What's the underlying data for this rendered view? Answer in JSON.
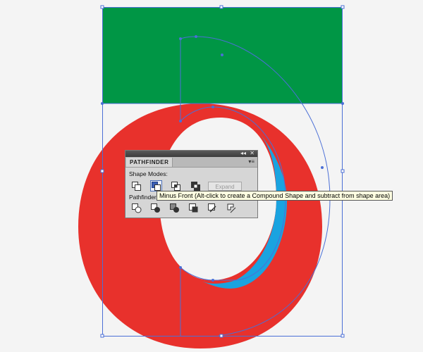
{
  "canvas": {
    "colors": {
      "background": "#f4f4f4",
      "rectangle": "#009645",
      "ring": "#e8312c",
      "inner_shadow": "#1aa3e0",
      "selection": "#4b6fd6"
    }
  },
  "panel": {
    "collapse_icon": "double-left-arrows-icon",
    "close_icon": "close-icon",
    "tab_label": "PATHFINDER",
    "menu_icon": "panel-menu-icon",
    "shape_modes_label": "Shape Modes:",
    "shape_modes": [
      {
        "name": "unite-icon"
      },
      {
        "name": "minus-front-icon",
        "active": true
      },
      {
        "name": "intersect-icon"
      },
      {
        "name": "exclude-icon"
      }
    ],
    "expand_label": "Expand",
    "pathfinders_label": "Pathfinder",
    "pathfinders": [
      {
        "name": "divide-icon"
      },
      {
        "name": "trim-icon"
      },
      {
        "name": "merge-icon"
      },
      {
        "name": "crop-icon"
      },
      {
        "name": "outline-icon"
      },
      {
        "name": "minus-back-icon"
      }
    ]
  },
  "tooltip": {
    "text": "Minus Front (Alt-click to create a Compound Shape and subtract from shape area)"
  }
}
